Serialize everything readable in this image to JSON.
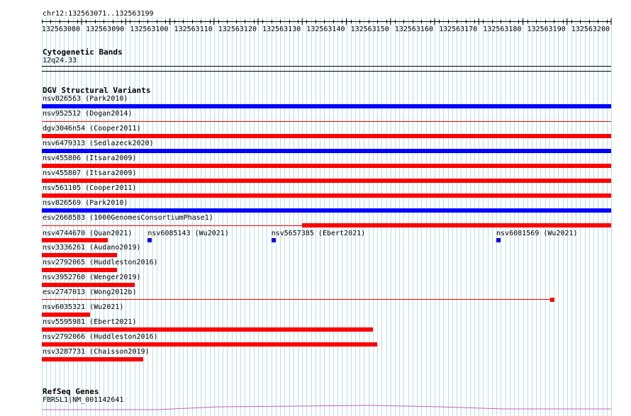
{
  "colors": {
    "deletion": "#ff0000",
    "duplication": "#0000ff",
    "gene": "#c060c0",
    "grid": "#b8dfea"
  },
  "locus": "chr12:132563071..132563199",
  "ruler": {
    "ticks": [
      "132563080",
      "132563090",
      "132563100",
      "132563110",
      "132563120",
      "132563130",
      "132563140",
      "132563150",
      "132563160",
      "132563170",
      "132563180",
      "132563190",
      "132563200"
    ]
  },
  "cytoband": {
    "title": "Cytogenetic Bands",
    "band": "12q24.33"
  },
  "dgv": {
    "title": "DGV Structural Variants",
    "variants": [
      {
        "id": "nsv826563",
        "study": "(Park2010)",
        "color": "blue",
        "start": 132563071,
        "end": 132563200
      },
      {
        "id": "nsv952512",
        "study": "(Dogan2014)",
        "color": "red-thin",
        "start": 132563071,
        "end": 132563200
      },
      {
        "id": "dgv3046n54",
        "study": "(Cooper2011)",
        "color": "red",
        "start": 132563071,
        "end": 132563200
      },
      {
        "id": "nsv6479313",
        "study": "(Sedlazeck2020)",
        "color": "blue",
        "start": 132563071,
        "end": 132563200
      },
      {
        "id": "nsv455806",
        "study": "(Itsara2009)",
        "color": "red",
        "start": 132563071,
        "end": 132563200
      },
      {
        "id": "nsv455807",
        "study": "(Itsara2009)",
        "color": "red",
        "start": 132563071,
        "end": 132563200
      },
      {
        "id": "nsv561105",
        "study": "(Cooper2011)",
        "color": "red",
        "start": 132563071,
        "end": 132563200
      },
      {
        "id": "nsv826569",
        "study": "(Park2010)",
        "color": "blue",
        "start": 132563071,
        "end": 132563200
      },
      {
        "id": "esv2668583",
        "study": "(1000GenomesConsortiumPhase1)",
        "color": "red",
        "start": 132563130,
        "end": 132563200
      }
    ],
    "compact_row": [
      {
        "id": "nsv4744670",
        "study": "(Quan2021)",
        "color": "red",
        "start": 132563071,
        "end": 132563086
      },
      {
        "id": "nsv6085143",
        "study": "(Wu2021)",
        "color": "blue",
        "start": 132563095,
        "end": 132563096
      },
      {
        "id": "nsv5657385",
        "study": "(Ebert2021)",
        "color": "blue",
        "start": 132563123,
        "end": 132563124
      },
      {
        "id": "nsv6081569",
        "study": "(Wu2021)",
        "color": "blue",
        "start": 132563174,
        "end": 132563175
      }
    ],
    "lower": [
      {
        "id": "nsv3336261",
        "study": "(Audano2019)",
        "color": "red",
        "start": 132563071,
        "end": 132563088
      },
      {
        "id": "nsv2792065",
        "study": "(Huddleston2016)",
        "color": "red",
        "start": 132563071,
        "end": 132563088
      },
      {
        "id": "nsv3952760",
        "study": "(Wenger2019)",
        "color": "red",
        "start": 132563071,
        "end": 132563092
      },
      {
        "id": "esv2747013",
        "study": "(Wong2012b)",
        "color": "red-end",
        "start": 132563071,
        "end": 132563187
      },
      {
        "id": "nsv6035321",
        "study": "(Wu2021)",
        "color": "red",
        "start": 132563071,
        "end": 132563082
      },
      {
        "id": "nsv5595981",
        "study": "(Ebert2021)",
        "color": "red",
        "start": 132563071,
        "end": 132563146
      },
      {
        "id": "nsv2792066",
        "study": "(Huddleston2016)",
        "color": "red",
        "start": 132563071,
        "end": 132563147
      },
      {
        "id": "nsv3287731",
        "study": "(Chaisson2019)",
        "color": "red",
        "start": 132563071,
        "end": 132563094
      }
    ]
  },
  "refseq": {
    "title": "RefSeq Genes",
    "gene": "FBRSL1|NM_001142641"
  }
}
